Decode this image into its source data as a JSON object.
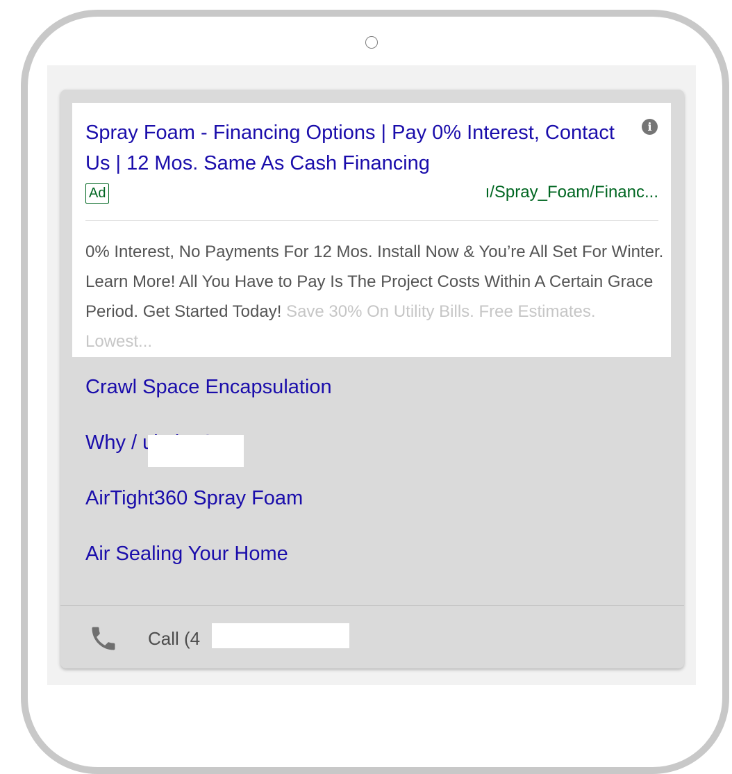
{
  "ad": {
    "headline": "Spray Foam - Financing Options | Pay 0% Interest, Contact Us | 12 Mos. Same As Cash Financing",
    "info_icon": "info-icon",
    "badge": "Ad",
    "display_url": "ı/Spray_Foam/Financ...",
    "description_visible": "0% Interest, No Payments For 12 Mos. Install Now & You’re All Set For Winter. Learn More! All You Have to Pay Is The Project Costs Within A Certain Grace Period. Get Started Today!",
    "description_faded": " Save 30% On Utility Bills. Free Estimates. Lowest..."
  },
  "sitelinks": [
    {
      "label": "Crawl Space Encapsulation"
    },
    {
      "label": "Why /          ulation?"
    },
    {
      "label": "AirTight360 Spray Foam"
    },
    {
      "label": "Air Sealing Your Home"
    }
  ],
  "call": {
    "icon": "phone-icon",
    "label": "Call (4"
  },
  "colors": {
    "link": "#1a0dab",
    "url_green": "#006621",
    "text": "#545454",
    "card_bg": "#dadada"
  }
}
